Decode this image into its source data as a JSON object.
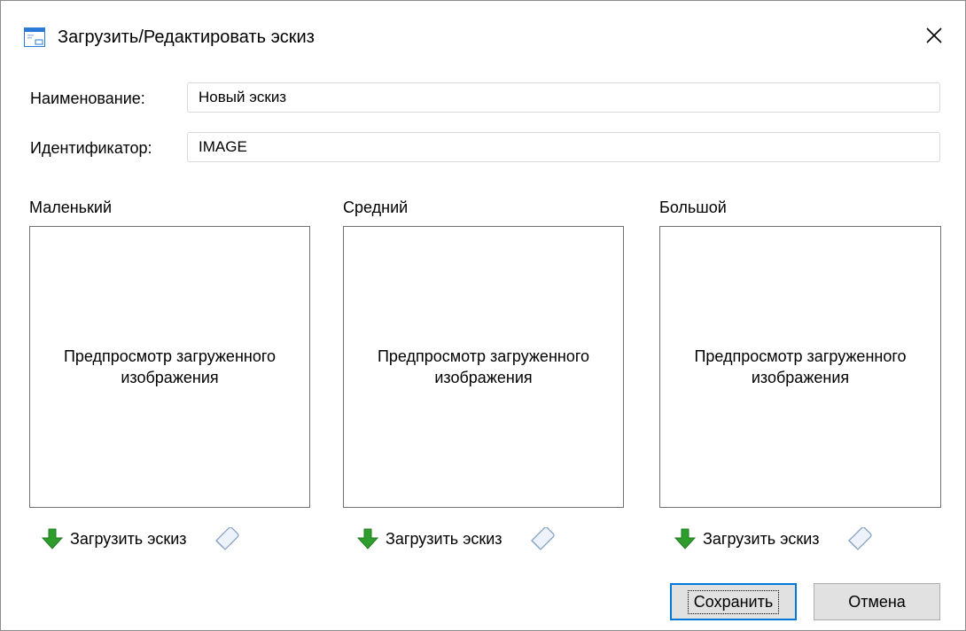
{
  "window": {
    "title": "Загрузить/Редактировать эскиз"
  },
  "form": {
    "name_label": "Наименование:",
    "name_value": "Новый эскиз",
    "id_label": "Идентификатор:",
    "id_value": "IMAGE"
  },
  "columns": [
    {
      "label": "Маленький",
      "preview_text": "Предпросмотр загруженного изображения",
      "upload_label": "Загрузить эскиз"
    },
    {
      "label": "Средний",
      "preview_text": "Предпросмотр загруженного изображения",
      "upload_label": "Загрузить эскиз"
    },
    {
      "label": "Большой",
      "preview_text": "Предпросмотр загруженного изображения",
      "upload_label": "Загрузить эскиз"
    }
  ],
  "buttons": {
    "save": "Сохранить",
    "cancel": "Отмена"
  },
  "icons": {
    "window": "window-icon",
    "close": "close-icon",
    "upload": "green-down-arrow-icon",
    "clear": "eraser-icon"
  },
  "colors": {
    "accent": "#0078d7",
    "upload_arrow": "#2e9d2e",
    "window_icon": "#2b7bd6"
  }
}
